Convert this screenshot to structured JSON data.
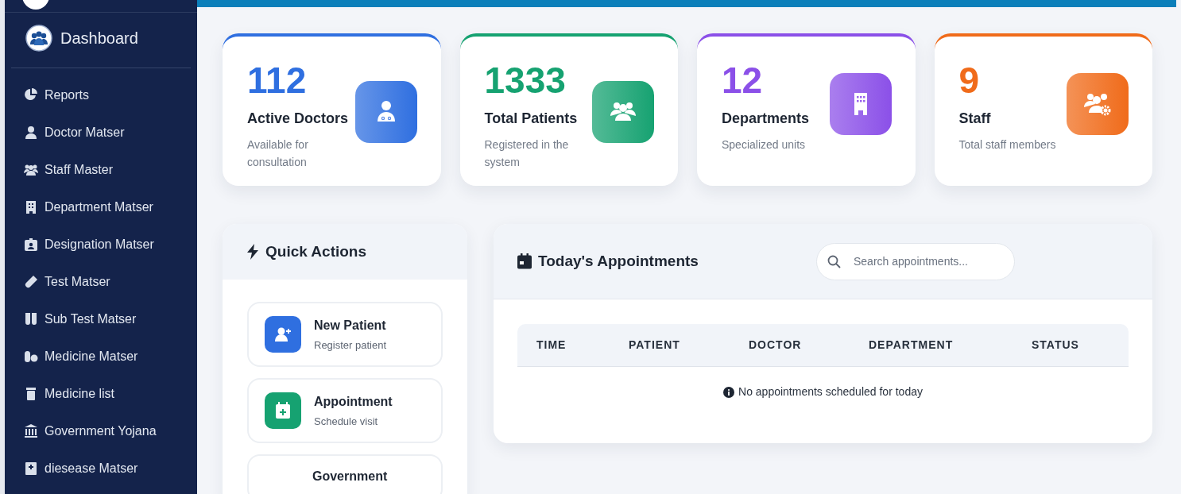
{
  "sidebar": {
    "brand": "Dashboard",
    "items": [
      {
        "label": "Reports"
      },
      {
        "label": "Doctor Matser"
      },
      {
        "label": "Staff Master"
      },
      {
        "label": "Department Matser"
      },
      {
        "label": "Designation Matser"
      },
      {
        "label": "Test Matser"
      },
      {
        "label": "Sub Test Matser"
      },
      {
        "label": "Medicine Matser"
      },
      {
        "label": "Medicine list"
      },
      {
        "label": "Government Yojana"
      },
      {
        "label": "diesease Matser"
      }
    ]
  },
  "stats": [
    {
      "value": "112",
      "label": "Active Doctors",
      "description": "Available for consultation",
      "color": "#2f6fe0"
    },
    {
      "value": "1333",
      "label": "Total Patients",
      "description": "Registered in the system",
      "color": "#16a271"
    },
    {
      "value": "12",
      "label": "Departments",
      "description": "Specialized units",
      "color": "#8b50e8"
    },
    {
      "value": "9",
      "label": "Staff",
      "description": "Total staff members",
      "color": "#f06b1a"
    }
  ],
  "quick_actions": {
    "title": "Quick Actions",
    "items": [
      {
        "title": "New Patient",
        "subtitle": "Register patient",
        "color": "#2f6fe0"
      },
      {
        "title": "Appointment",
        "subtitle": "Schedule visit",
        "color": "#16a271"
      },
      {
        "title": "Government"
      }
    ]
  },
  "appointments": {
    "title": "Today's Appointments",
    "search": {
      "placeholder": "Search appointments..."
    },
    "table": {
      "columns": [
        "TIME",
        "PATIENT",
        "DOCTOR",
        "DEPARTMENT",
        "STATUS"
      ],
      "empty_message": "No appointments scheduled for today"
    }
  }
}
